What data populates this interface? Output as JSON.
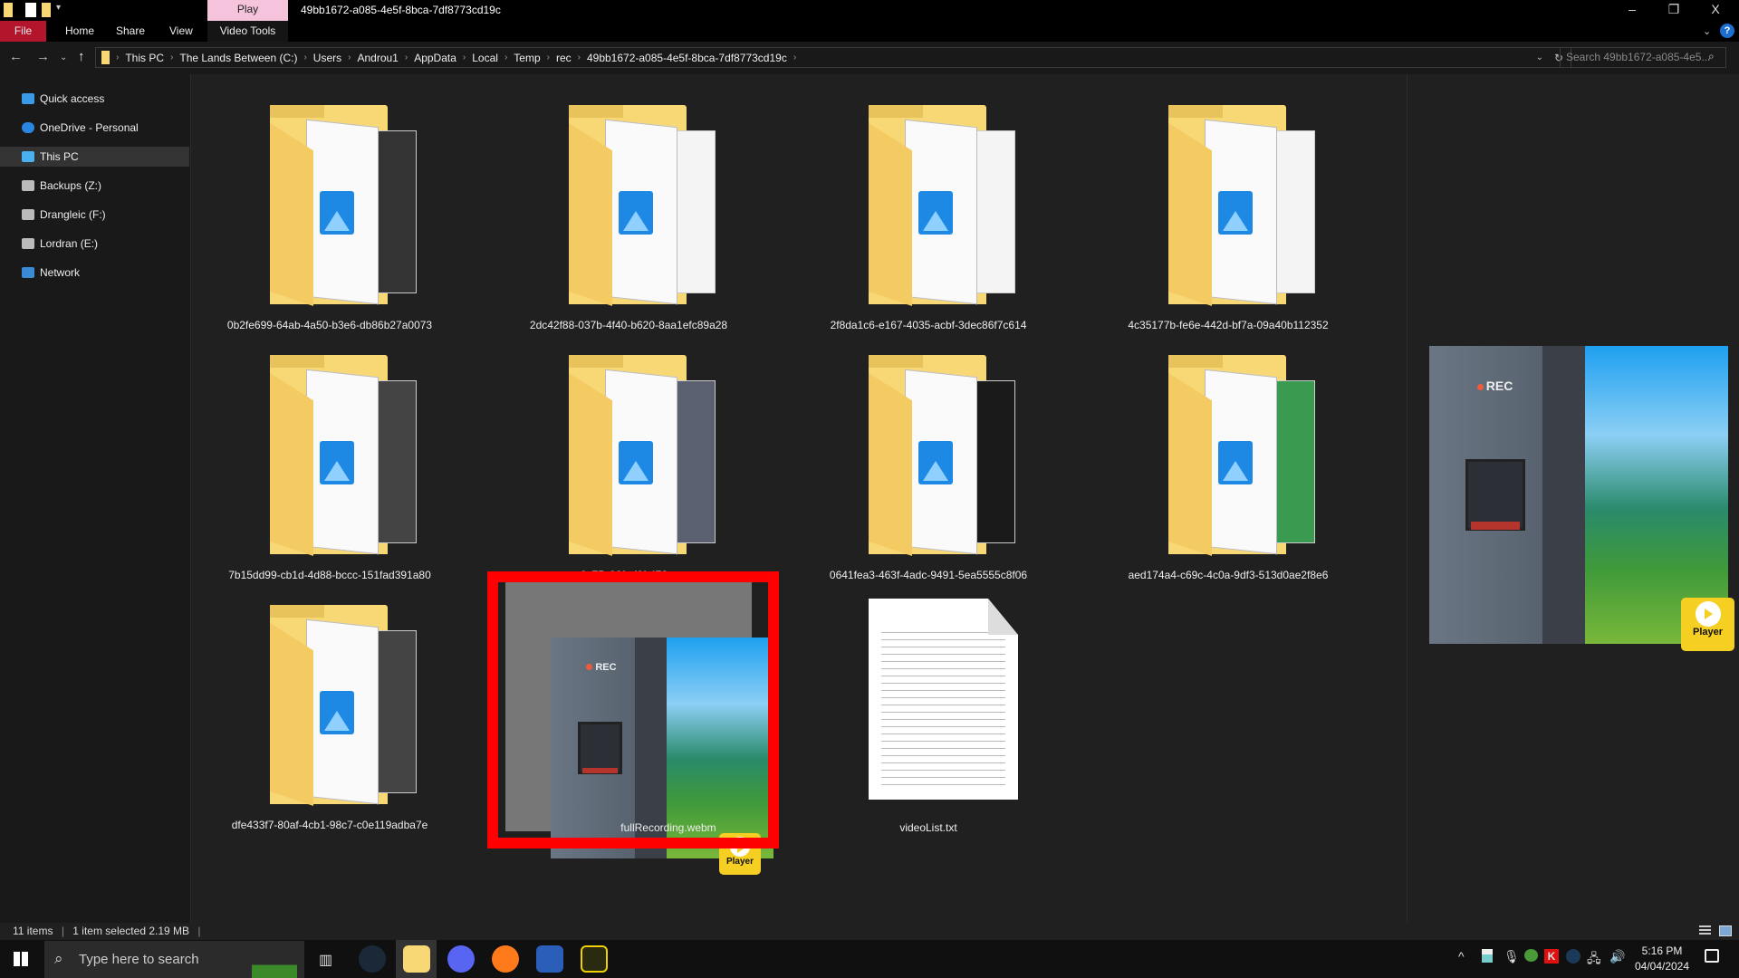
{
  "window": {
    "title": "49bb1672-a085-4e5f-8bca-7df8773cd19c",
    "context_tab": "Play",
    "minimize": "–",
    "restore": "❐",
    "close": "X"
  },
  "ribbon": {
    "tabs": [
      "File",
      "Home",
      "Share",
      "View"
    ],
    "context_tab": "Video Tools",
    "help": "?"
  },
  "address": {
    "crumbs": [
      "This PC",
      "The Lands Between (C:)",
      "Users",
      "Androu1",
      "AppData",
      "Local",
      "Temp",
      "rec",
      "49bb1672-a085-4e5f-8bca-7df8773cd19c"
    ],
    "search_placeholder": "Search 49bb1672-a085-4e5..."
  },
  "sidebar": {
    "items": [
      {
        "label": "Quick access",
        "icon": "star-icon"
      },
      {
        "label": "OneDrive - Personal",
        "icon": "cloud-icon"
      },
      {
        "label": "This PC",
        "icon": "computer-icon",
        "selected": true
      },
      {
        "label": "Backups (Z:)",
        "icon": "drive-icon"
      },
      {
        "label": "Drangleic (F:)",
        "icon": "drive-icon"
      },
      {
        "label": "Lordran (E:)",
        "icon": "drive-icon"
      },
      {
        "label": "Network",
        "icon": "network-icon"
      }
    ]
  },
  "files": [
    {
      "name": "0b2fe699-64ab-4a50-b3e6-db86b27a0073",
      "type": "folder",
      "thumb": "#333"
    },
    {
      "name": "2dc42f88-037b-4f40-b620-8aa1efc89a28",
      "type": "folder",
      "thumb": "#f4f4f4"
    },
    {
      "name": "2f8da1c6-e167-4035-acbf-3dec86f7c614",
      "type": "folder",
      "thumb": "#f4f4f4"
    },
    {
      "name": "4c35177b-fe6e-442d-bf7a-09a40b112352",
      "type": "folder",
      "thumb": "#f4f4f4"
    },
    {
      "name": "7b15dd99-cb1d-4d88-bccc-151fad391a80",
      "type": "folder",
      "thumb": "#444"
    },
    {
      "name": "0c75c06f-cf6f-472...",
      "type": "folder",
      "thumb": "#5a6070"
    },
    {
      "name": "0641fea3-463f-4adc-9491-5ea5555c8f06",
      "type": "folder",
      "thumb": "#1a1a1a"
    },
    {
      "name": "aed174a4-c69c-4c0a-9df3-513d0ae2f8e6",
      "type": "folder",
      "thumb": "#3a9a50"
    },
    {
      "name": "dfe433f7-80af-4cb1-98c7-c0e119adba7e",
      "type": "folder",
      "thumb": "#444"
    },
    {
      "name": "fullRecording.webm",
      "type": "video",
      "selected": true
    },
    {
      "name": "videoList.txt",
      "type": "text"
    }
  ],
  "video_overlay": {
    "rec": "REC",
    "badge": "Player"
  },
  "status": {
    "items": "11 items",
    "selection": "1 item selected  2.19 MB"
  },
  "taskbar": {
    "search_placeholder": "Type here to search",
    "time": "5:16 PM",
    "date": "04/04/2024"
  },
  "colors": {
    "accent_file_tab": "#b2152c",
    "highlight_box": "#ff0000",
    "play_tab": "#f5c4dc",
    "player_badge": "#f5cf21"
  }
}
